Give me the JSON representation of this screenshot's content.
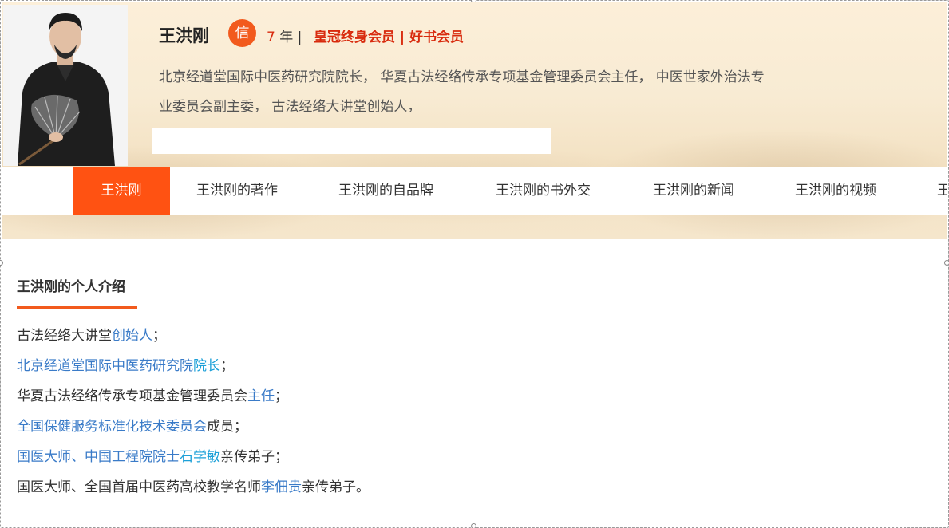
{
  "profile": {
    "name": "王洪刚",
    "badge": "信",
    "years_num": "7",
    "years_suffix": " 年 |",
    "vip_text": "皇冠终身会员 | 好书会员",
    "bio_line1": "北京经道堂国际中医药研究院院长， 华夏古法经络传承专项基金管理委员会主任， 中医世家外治法专",
    "bio_line2": "业委员会副主委， 古法经络大讲堂创始人，"
  },
  "nav": {
    "items": [
      {
        "label": "王洪刚",
        "active": true
      },
      {
        "label": "王洪刚的著作"
      },
      {
        "label": "王洪刚的自品牌"
      },
      {
        "label": "王洪刚的书外交"
      },
      {
        "label": "王洪刚的新闻"
      },
      {
        "label": "王洪刚的视频"
      },
      {
        "label": "王"
      }
    ]
  },
  "section": {
    "title": "王洪刚的个人介绍"
  },
  "intro": {
    "line1": {
      "t1": "古法经络大讲堂",
      "l1": "创始人",
      "t2": "；"
    },
    "line2": {
      "l1": "北京经道堂国际中医药研究院",
      "l2": "院长",
      "t1": "；"
    },
    "line3": {
      "t1": "华夏古法经络传承专项基金管理委员会",
      "l1": "主任",
      "t2": "；"
    },
    "line4": {
      "l1": "全国保健服务标准化技术委员会",
      "t1": "成员；"
    },
    "line5": {
      "l1": "国医大师、中国工程院院士",
      "l2": "石学敏",
      "t1": "亲传弟子；"
    },
    "line6": {
      "t1": "国医大师、全国首届中医药高校教学名师",
      "l1": "李佃贵",
      "t2": "亲传弟子。"
    }
  },
  "colors": {
    "accent": "#ff5212",
    "vip_red": "#d82a0d",
    "link_blue": "#3a7bc8"
  }
}
